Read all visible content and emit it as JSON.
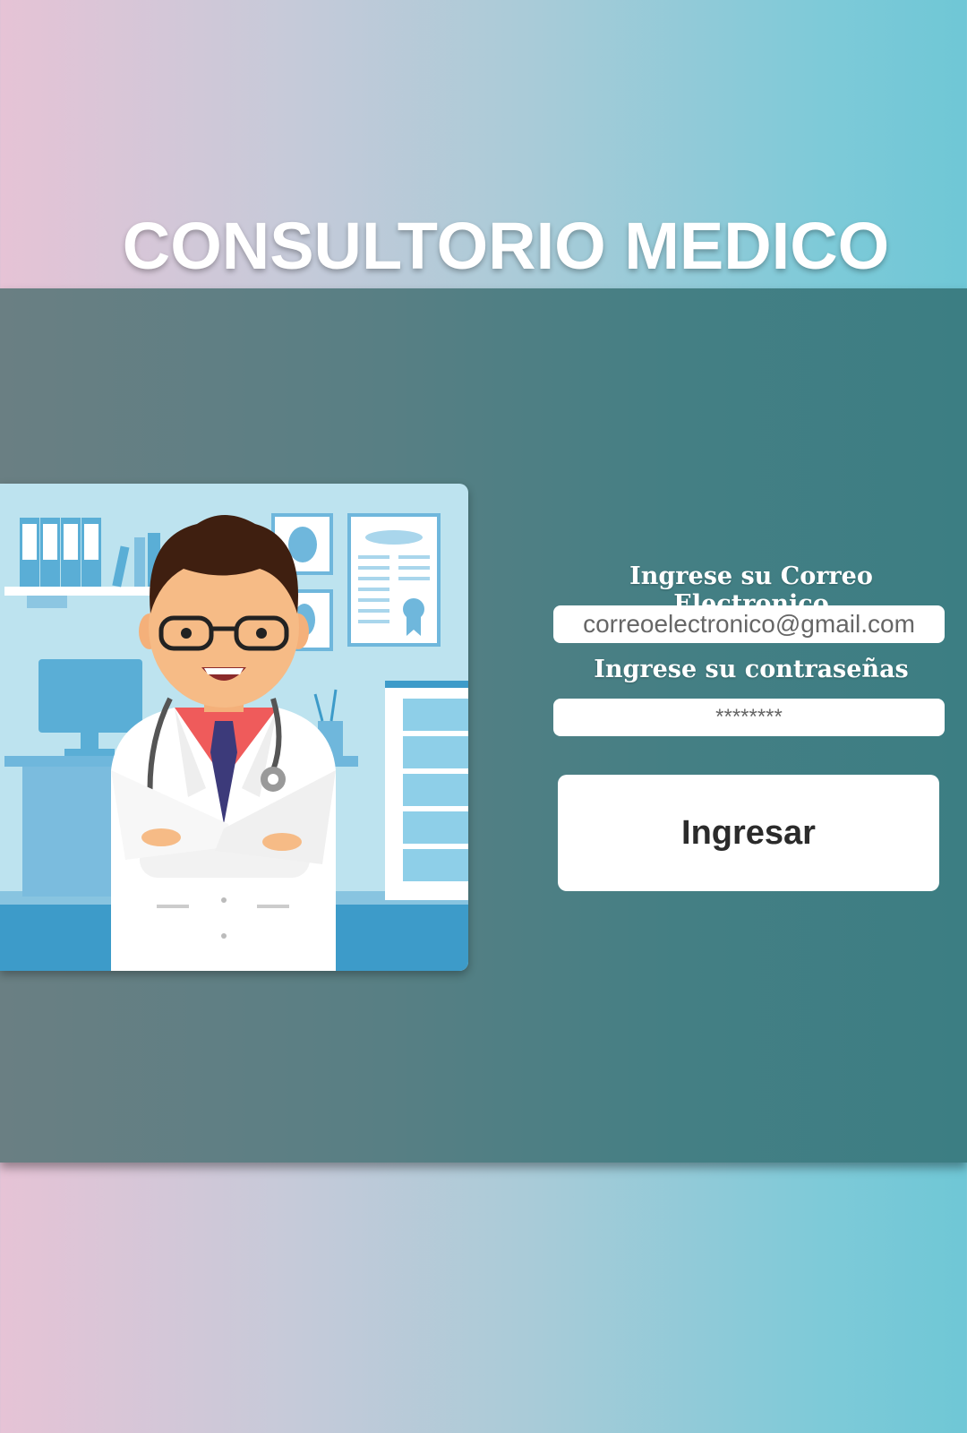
{
  "header": {
    "title": "CONSULTORIO MEDICO"
  },
  "login_form": {
    "email_label": "Ingrese su Correo Electronico",
    "email_placeholder": "correoelectronico@gmail.com",
    "password_label": "Ingrese su contraseñas",
    "password_placeholder": "********",
    "submit_label": "Ingresar"
  },
  "illustration": {
    "icon": "doctor-illustration"
  },
  "colors": {
    "background_gradient": [
      "#e6c3d6",
      "#6fc7d6"
    ],
    "panel_gradient": [
      "#6a7f83",
      "#3c7e83"
    ],
    "button_bg": "#ffffff",
    "title_text": "#ffffff"
  }
}
